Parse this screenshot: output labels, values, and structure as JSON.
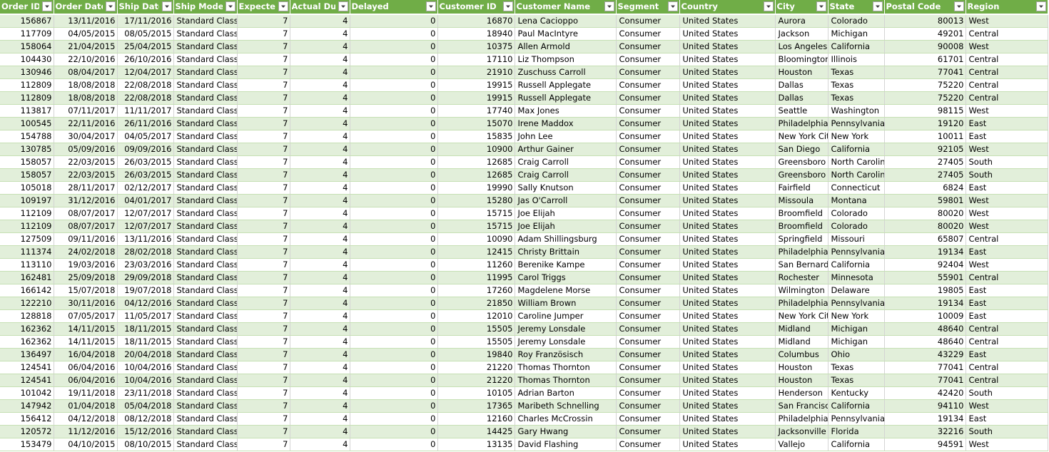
{
  "columns": [
    {
      "label": "Order ID",
      "key": "order_id",
      "align": "num"
    },
    {
      "label": "Order Date",
      "key": "order_date",
      "align": "num"
    },
    {
      "label": "Ship Date",
      "key": "ship_date",
      "align": "num"
    },
    {
      "label": "Ship Mode",
      "key": "ship_mode",
      "align": "txt"
    },
    {
      "label": "Expected",
      "key": "expected",
      "align": "num"
    },
    {
      "label": "Actual Dura",
      "key": "actual",
      "align": "num"
    },
    {
      "label": "Delayed",
      "key": "delayed",
      "align": "num"
    },
    {
      "label": "Customer ID",
      "key": "customer_id",
      "align": "num"
    },
    {
      "label": "Customer Name",
      "key": "customer_name",
      "align": "txt"
    },
    {
      "label": "Segment",
      "key": "segment",
      "align": "txt"
    },
    {
      "label": "Country",
      "key": "country",
      "align": "txt"
    },
    {
      "label": "City",
      "key": "city",
      "align": "txt"
    },
    {
      "label": "State",
      "key": "state",
      "align": "txt"
    },
    {
      "label": "Postal Code",
      "key": "postal",
      "align": "num"
    },
    {
      "label": "Region",
      "key": "region",
      "align": "txt"
    }
  ],
  "rows": [
    [
      "156867",
      "13/11/2016",
      "17/11/2016",
      "Standard Class",
      "7",
      "4",
      "0",
      "16870",
      "Lena Cacioppo",
      "Consumer",
      "United States",
      "Aurora",
      "Colorado",
      "80013",
      "West"
    ],
    [
      "117709",
      "04/05/2015",
      "08/05/2015",
      "Standard Class",
      "7",
      "4",
      "0",
      "18940",
      "Paul MacIntyre",
      "Consumer",
      "United States",
      "Jackson",
      "Michigan",
      "49201",
      "Central"
    ],
    [
      "158064",
      "21/04/2015",
      "25/04/2015",
      "Standard Class",
      "7",
      "4",
      "0",
      "10375",
      "Allen Armold",
      "Consumer",
      "United States",
      "Los Angeles",
      "California",
      "90008",
      "West"
    ],
    [
      "104430",
      "22/10/2016",
      "26/10/2016",
      "Standard Class",
      "7",
      "4",
      "0",
      "17110",
      "Liz Thompson",
      "Consumer",
      "United States",
      "Bloomington",
      "Illinois",
      "61701",
      "Central"
    ],
    [
      "130946",
      "08/04/2017",
      "12/04/2017",
      "Standard Class",
      "7",
      "4",
      "0",
      "21910",
      "Zuschuss Carroll",
      "Consumer",
      "United States",
      "Houston",
      "Texas",
      "77041",
      "Central"
    ],
    [
      "112809",
      "18/08/2018",
      "22/08/2018",
      "Standard Class",
      "7",
      "4",
      "0",
      "19915",
      "Russell Applegate",
      "Consumer",
      "United States",
      "Dallas",
      "Texas",
      "75220",
      "Central"
    ],
    [
      "112809",
      "18/08/2018",
      "22/08/2018",
      "Standard Class",
      "7",
      "4",
      "0",
      "19915",
      "Russell Applegate",
      "Consumer",
      "United States",
      "Dallas",
      "Texas",
      "75220",
      "Central"
    ],
    [
      "113817",
      "07/11/2017",
      "11/11/2017",
      "Standard Class",
      "7",
      "4",
      "0",
      "17740",
      "Max Jones",
      "Consumer",
      "United States",
      "Seattle",
      "Washington",
      "98115",
      "West"
    ],
    [
      "100545",
      "22/11/2016",
      "26/11/2016",
      "Standard Class",
      "7",
      "4",
      "0",
      "15070",
      "Irene Maddox",
      "Consumer",
      "United States",
      "Philadelphia",
      "Pennsylvania",
      "19120",
      "East"
    ],
    [
      "154788",
      "30/04/2017",
      "04/05/2017",
      "Standard Class",
      "7",
      "4",
      "0",
      "15835",
      "John Lee",
      "Consumer",
      "United States",
      "New York City",
      "New York",
      "10011",
      "East"
    ],
    [
      "130785",
      "05/09/2016",
      "09/09/2016",
      "Standard Class",
      "7",
      "4",
      "0",
      "10900",
      "Arthur Gainer",
      "Consumer",
      "United States",
      "San Diego",
      "California",
      "92105",
      "West"
    ],
    [
      "158057",
      "22/03/2015",
      "26/03/2015",
      "Standard Class",
      "7",
      "4",
      "0",
      "12685",
      "Craig Carroll",
      "Consumer",
      "United States",
      "Greensboro",
      "North Carolina",
      "27405",
      "South"
    ],
    [
      "158057",
      "22/03/2015",
      "26/03/2015",
      "Standard Class",
      "7",
      "4",
      "0",
      "12685",
      "Craig Carroll",
      "Consumer",
      "United States",
      "Greensboro",
      "North Carolina",
      "27405",
      "South"
    ],
    [
      "105018",
      "28/11/2017",
      "02/12/2017",
      "Standard Class",
      "7",
      "4",
      "0",
      "19990",
      "Sally Knutson",
      "Consumer",
      "United States",
      "Fairfield",
      "Connecticut",
      "6824",
      "East"
    ],
    [
      "109197",
      "31/12/2016",
      "04/01/2017",
      "Standard Class",
      "7",
      "4",
      "0",
      "15280",
      "Jas O'Carroll",
      "Consumer",
      "United States",
      "Missoula",
      "Montana",
      "59801",
      "West"
    ],
    [
      "112109",
      "08/07/2017",
      "12/07/2017",
      "Standard Class",
      "7",
      "4",
      "0",
      "15715",
      "Joe Elijah",
      "Consumer",
      "United States",
      "Broomfield",
      "Colorado",
      "80020",
      "West"
    ],
    [
      "112109",
      "08/07/2017",
      "12/07/2017",
      "Standard Class",
      "7",
      "4",
      "0",
      "15715",
      "Joe Elijah",
      "Consumer",
      "United States",
      "Broomfield",
      "Colorado",
      "80020",
      "West"
    ],
    [
      "127509",
      "09/11/2016",
      "13/11/2016",
      "Standard Class",
      "7",
      "4",
      "0",
      "10090",
      "Adam Shillingsburg",
      "Consumer",
      "United States",
      "Springfield",
      "Missouri",
      "65807",
      "Central"
    ],
    [
      "111374",
      "24/02/2018",
      "28/02/2018",
      "Standard Class",
      "7",
      "4",
      "0",
      "12415",
      "Christy Brittain",
      "Consumer",
      "United States",
      "Philadelphia",
      "Pennsylvania",
      "19134",
      "East"
    ],
    [
      "113110",
      "19/03/2016",
      "23/03/2016",
      "Standard Class",
      "7",
      "4",
      "0",
      "11260",
      "Berenike Kampe",
      "Consumer",
      "United States",
      "San Bernardino",
      "California",
      "92404",
      "West"
    ],
    [
      "162481",
      "25/09/2018",
      "29/09/2018",
      "Standard Class",
      "7",
      "4",
      "0",
      "11995",
      "Carol Triggs",
      "Consumer",
      "United States",
      "Rochester",
      "Minnesota",
      "55901",
      "Central"
    ],
    [
      "166142",
      "15/07/2018",
      "19/07/2018",
      "Standard Class",
      "7",
      "4",
      "0",
      "17260",
      "Magdelene Morse",
      "Consumer",
      "United States",
      "Wilmington",
      "Delaware",
      "19805",
      "East"
    ],
    [
      "122210",
      "30/11/2016",
      "04/12/2016",
      "Standard Class",
      "7",
      "4",
      "0",
      "21850",
      "William Brown",
      "Consumer",
      "United States",
      "Philadelphia",
      "Pennsylvania",
      "19134",
      "East"
    ],
    [
      "128818",
      "07/05/2017",
      "11/05/2017",
      "Standard Class",
      "7",
      "4",
      "0",
      "12010",
      "Caroline Jumper",
      "Consumer",
      "United States",
      "New York City",
      "New York",
      "10009",
      "East"
    ],
    [
      "162362",
      "14/11/2015",
      "18/11/2015",
      "Standard Class",
      "7",
      "4",
      "0",
      "15505",
      "Jeremy Lonsdale",
      "Consumer",
      "United States",
      "Midland",
      "Michigan",
      "48640",
      "Central"
    ],
    [
      "162362",
      "14/11/2015",
      "18/11/2015",
      "Standard Class",
      "7",
      "4",
      "0",
      "15505",
      "Jeremy Lonsdale",
      "Consumer",
      "United States",
      "Midland",
      "Michigan",
      "48640",
      "Central"
    ],
    [
      "136497",
      "16/04/2018",
      "20/04/2018",
      "Standard Class",
      "7",
      "4",
      "0",
      "19840",
      "Roy Französisch",
      "Consumer",
      "United States",
      "Columbus",
      "Ohio",
      "43229",
      "East"
    ],
    [
      "124541",
      "06/04/2016",
      "10/04/2016",
      "Standard Class",
      "7",
      "4",
      "0",
      "21220",
      "Thomas Thornton",
      "Consumer",
      "United States",
      "Houston",
      "Texas",
      "77041",
      "Central"
    ],
    [
      "124541",
      "06/04/2016",
      "10/04/2016",
      "Standard Class",
      "7",
      "4",
      "0",
      "21220",
      "Thomas Thornton",
      "Consumer",
      "United States",
      "Houston",
      "Texas",
      "77041",
      "Central"
    ],
    [
      "101042",
      "19/11/2018",
      "23/11/2018",
      "Standard Class",
      "7",
      "4",
      "0",
      "10105",
      "Adrian Barton",
      "Consumer",
      "United States",
      "Henderson",
      "Kentucky",
      "42420",
      "South"
    ],
    [
      "147942",
      "01/04/2018",
      "05/04/2018",
      "Standard Class",
      "7",
      "4",
      "0",
      "17365",
      "Maribeth Schnelling",
      "Consumer",
      "United States",
      "San Francisco",
      "California",
      "94110",
      "West"
    ],
    [
      "156412",
      "04/12/2018",
      "08/12/2018",
      "Standard Class",
      "7",
      "4",
      "0",
      "12160",
      "Charles McCrossin",
      "Consumer",
      "United States",
      "Philadelphia",
      "Pennsylvania",
      "19134",
      "East"
    ],
    [
      "120572",
      "11/12/2016",
      "15/12/2016",
      "Standard Class",
      "7",
      "4",
      "0",
      "14425",
      "Gary Hwang",
      "Consumer",
      "United States",
      "Jacksonville",
      "Florida",
      "32216",
      "South"
    ],
    [
      "153479",
      "04/10/2015",
      "08/10/2015",
      "Standard Class",
      "7",
      "4",
      "0",
      "13135",
      "David Flashing",
      "Consumer",
      "United States",
      "Vallejo",
      "California",
      "94591",
      "West"
    ]
  ]
}
